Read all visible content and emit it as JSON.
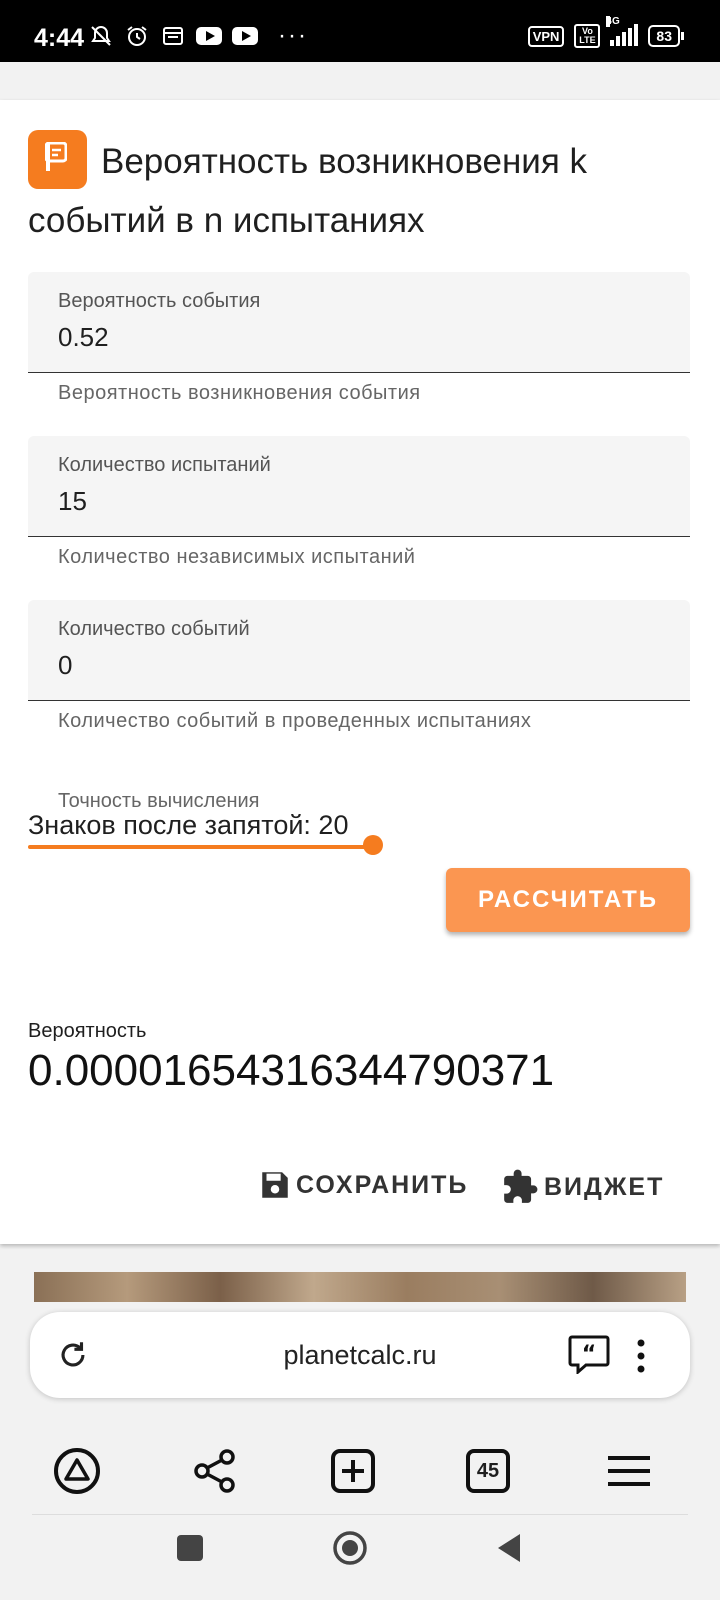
{
  "status_bar": {
    "time": "4:44",
    "vpn": "VPN",
    "volte": "Vo LTE",
    "network": "4G",
    "battery": "83"
  },
  "calculator": {
    "title": "Вероятность возникновения k событий в n испытаниях",
    "fields": [
      {
        "label": "Вероятность события",
        "value": "0.52",
        "helper": "Вероятность возникновения события"
      },
      {
        "label": "Количество испытаний",
        "value": "15",
        "helper": "Количество независимых испытаний"
      },
      {
        "label": "Количество событий",
        "value": "0",
        "helper": "Количество событий в проведенных испытаниях"
      }
    ],
    "precision": {
      "label": "Точность вычисления",
      "digits_label": "Знаков после запятой: 20",
      "level": 1.0
    },
    "calculate_label": "РАССЧИТАТЬ",
    "result": {
      "label": "Вероятность",
      "value": "0.0000165431634479037​1"
    },
    "save_label": "СОХРАНИТЬ",
    "widget_label": "ВИДЖЕТ"
  },
  "browser": {
    "url": "planetcalc.ru",
    "tab_count": "45",
    "icons": [
      "reload-icon",
      "quote-icon",
      "more-vert-icon",
      "alice-icon",
      "share-icon",
      "new-tab-icon",
      "tabs-icon",
      "menu-icon"
    ]
  },
  "colors": {
    "accent": "#f57c1f",
    "button": "#fb9651"
  }
}
